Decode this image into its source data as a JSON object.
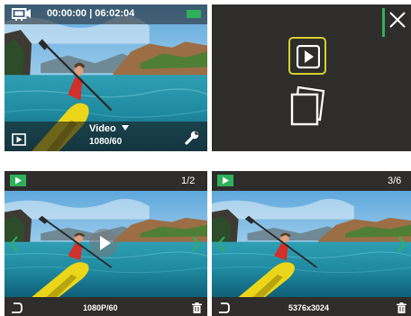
{
  "panels": {
    "video": {
      "timer": "00:00:00 | 06:02:04",
      "mode_label": "Video",
      "resolution": "1080/60",
      "mode_dropdown_icon": "caret-down-icon",
      "battery_color": "#2fb05a"
    },
    "playback_menu": {
      "icons": [
        "close-icon",
        "play-video-icon",
        "photo-album-icon"
      ],
      "accent": "#d4cf2e",
      "divider_color": "#2fb05a"
    },
    "video_playback": {
      "page": "1/2",
      "info": "1080P/60",
      "icons": [
        "play-badge-icon",
        "prev-chevron-icon",
        "next-chevron-icon",
        "play-overlay-icon",
        "back-icon",
        "trash-icon"
      ]
    },
    "photo_playback": {
      "page": "3/6",
      "info": "5376x3024",
      "icons": [
        "play-badge-icon",
        "prev-chevron-icon",
        "next-chevron-icon",
        "back-icon",
        "trash-icon"
      ]
    }
  },
  "colors": {
    "screen_bg": "#2e2d2b",
    "green": "#2fb05a",
    "chevron": "#2fb05a"
  }
}
